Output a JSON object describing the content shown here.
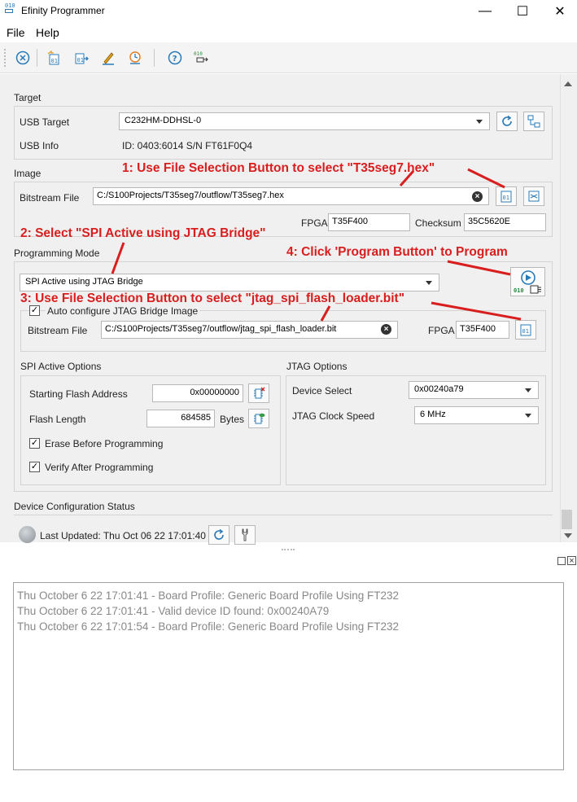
{
  "window": {
    "title": "Efinity Programmer",
    "icon_text": "010",
    "minimize": "—",
    "maximize": "☐",
    "close": "✕"
  },
  "menu": [
    "File",
    "Help"
  ],
  "toolbar": {
    "icons": [
      "cancel-icon",
      "open-file-icon",
      "load-icon",
      "edit-icon",
      "clock-icon",
      "help-icon",
      "program-icon"
    ]
  },
  "target": {
    "section_title": "Target",
    "usb_target_label": "USB Target",
    "usb_target_value": "C232HM-DDHSL-0",
    "usb_info_label": "USB Info",
    "usb_info_value": "ID: 0403:6014 S/N FT61F0Q4"
  },
  "image": {
    "section_title": "Image",
    "bitstream_label": "Bitstream File",
    "bitstream_value": "C:/S100Projects/T35seg7/outflow/T35seg7.hex",
    "fpga_label": "FPGA",
    "fpga_value": "T35F400",
    "checksum_label": "Checksum",
    "checksum_value": "35C5620E"
  },
  "programming_mode": {
    "section_title": "Programming Mode",
    "mode_value": "SPI Active using JTAG Bridge",
    "auto_config_label": "Auto configure JTAG Bridge Image",
    "auto_config_checked": true,
    "bitstream_label": "Bitstream File",
    "bitstream_value": "C:/S100Projects/T35seg7/outflow/jtag_spi_flash_loader.bit",
    "fpga_label": "FPGA",
    "fpga_value": "T35F400"
  },
  "spi_options": {
    "title": "SPI Active Options",
    "start_addr_label": "Starting Flash Address",
    "start_addr_value": "0x00000000",
    "flash_len_label": "Flash Length",
    "flash_len_value": "684585",
    "flash_len_unit": "Bytes",
    "erase_label": "Erase Before Programming",
    "verify_label": "Verify After Programming"
  },
  "jtag_options": {
    "title": "JTAG Options",
    "device_select_label": "Device Select",
    "device_select_value": "0x00240a79",
    "clock_label": "JTAG Clock Speed",
    "clock_value": "6 MHz"
  },
  "status": {
    "title": "Device Configuration Status",
    "last_updated": "Last Updated: Thu Oct 06 22 17:01:40"
  },
  "annotations": {
    "step1": "1: Use File Selection Button to select \"T35seg7.hex\"",
    "step2": "2: Select \"SPI Active using JTAG Bridge\"",
    "step3": "3: Use File Selection Button to select \"jtag_spi_flash_loader.bit\"",
    "step4": "4: Click 'Program Button' to Program"
  },
  "log": [
    "Thu October 6 22 17:01:41 - Board Profile: Generic Board Profile Using FT232",
    "Thu October 6 22 17:01:41 - Valid device ID found: 0x00240A79",
    "Thu October 6 22 17:01:54 - Board Profile: Generic Board Profile Using FT232"
  ],
  "colors": {
    "annotation": "#d81e1e",
    "accent": "#2a7ab8",
    "panel": "#f0f0f0"
  }
}
